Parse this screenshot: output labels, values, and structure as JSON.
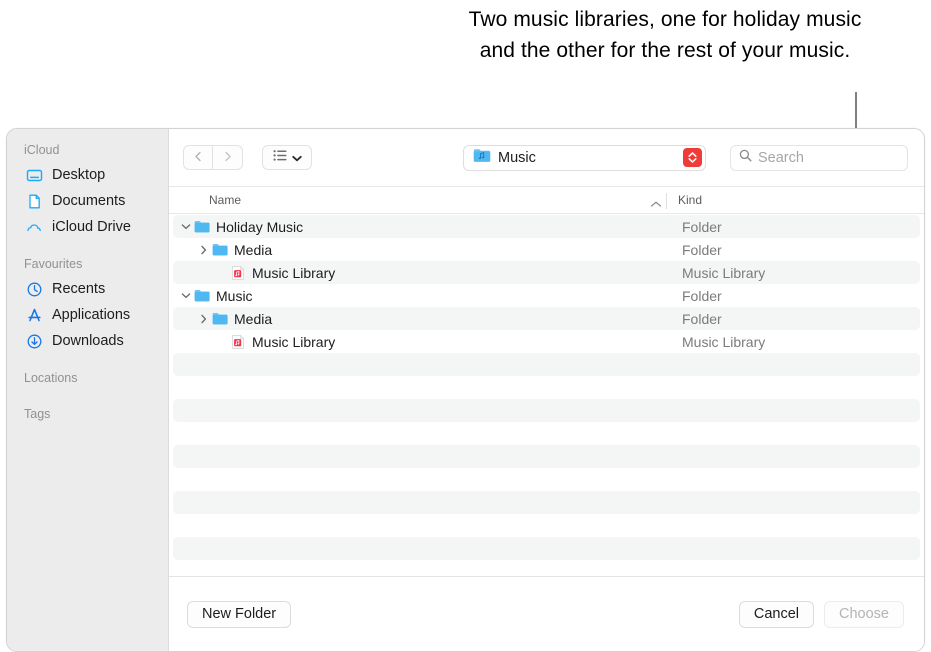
{
  "annotation": {
    "text": "Two music libraries, one for holiday music and the other for the rest of your music.",
    "line_color": "#808080"
  },
  "sidebar": {
    "groups": [
      {
        "title": "iCloud",
        "items": [
          {
            "label": "Desktop",
            "icon": "desktop-icon"
          },
          {
            "label": "Documents",
            "icon": "document-icon"
          },
          {
            "label": "iCloud Drive",
            "icon": "cloud-icon"
          }
        ]
      },
      {
        "title": "Favourites",
        "items": [
          {
            "label": "Recents",
            "icon": "clock-icon"
          },
          {
            "label": "Applications",
            "icon": "applications-icon"
          },
          {
            "label": "Downloads",
            "icon": "download-icon"
          }
        ]
      },
      {
        "title": "Locations",
        "items": []
      },
      {
        "title": "Tags",
        "items": []
      }
    ]
  },
  "toolbar": {
    "back_icon": "chevron-left-icon",
    "forward_icon": "chevron-right-icon",
    "view_icon": "list-view-icon",
    "view_chevron_icon": "chevron-down-icon",
    "location": {
      "label": "Music",
      "icon": "music-folder-icon",
      "chevrons_icon": "up-down-chevrons-icon",
      "accent": "#f03c38"
    },
    "search": {
      "placeholder": "Search",
      "icon": "search-icon"
    }
  },
  "columns": {
    "name": "Name",
    "kind": "Kind",
    "sort_icon": "chevron-up-icon"
  },
  "files": [
    {
      "name": "Holiday Music",
      "kind": "Folder",
      "indent": 0,
      "icon": "folder-icon",
      "disclosure": "expanded",
      "striped": true
    },
    {
      "name": "Media",
      "kind": "Folder",
      "indent": 1,
      "icon": "folder-icon",
      "disclosure": "collapsed",
      "striped": false
    },
    {
      "name": "Music Library",
      "kind": "Music Library",
      "indent": 2,
      "icon": "music-library-icon",
      "disclosure": "none",
      "striped": true
    },
    {
      "name": "Music",
      "kind": "Folder",
      "indent": 0,
      "icon": "folder-icon",
      "disclosure": "expanded",
      "striped": false
    },
    {
      "name": "Media",
      "kind": "Folder",
      "indent": 1,
      "icon": "folder-icon",
      "disclosure": "collapsed",
      "striped": true
    },
    {
      "name": "Music Library",
      "kind": "Music Library",
      "indent": 2,
      "icon": "music-library-icon",
      "disclosure": "none",
      "striped": false
    },
    {
      "name": "",
      "kind": "",
      "indent": 0,
      "icon": "none",
      "disclosure": "none",
      "striped": true
    },
    {
      "name": "",
      "kind": "",
      "indent": 0,
      "icon": "none",
      "disclosure": "none",
      "striped": false
    },
    {
      "name": "",
      "kind": "",
      "indent": 0,
      "icon": "none",
      "disclosure": "none",
      "striped": true
    },
    {
      "name": "",
      "kind": "",
      "indent": 0,
      "icon": "none",
      "disclosure": "none",
      "striped": false
    },
    {
      "name": "",
      "kind": "",
      "indent": 0,
      "icon": "none",
      "disclosure": "none",
      "striped": true
    },
    {
      "name": "",
      "kind": "",
      "indent": 0,
      "icon": "none",
      "disclosure": "none",
      "striped": false
    },
    {
      "name": "",
      "kind": "",
      "indent": 0,
      "icon": "none",
      "disclosure": "none",
      "striped": true
    },
    {
      "name": "",
      "kind": "",
      "indent": 0,
      "icon": "none",
      "disclosure": "none",
      "striped": false
    },
    {
      "name": "",
      "kind": "",
      "indent": 0,
      "icon": "none",
      "disclosure": "none",
      "striped": true
    }
  ],
  "footer": {
    "new_folder": "New Folder",
    "cancel": "Cancel",
    "choose": "Choose",
    "choose_disabled": true
  }
}
